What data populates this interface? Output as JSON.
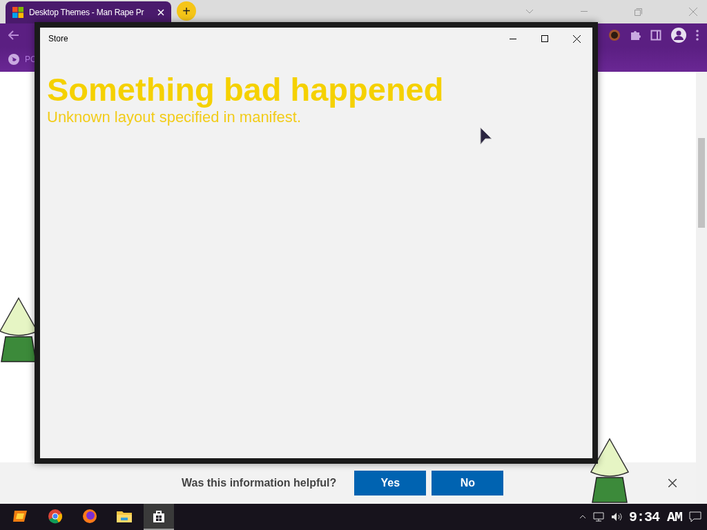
{
  "browser": {
    "tab": {
      "title": "Desktop Themes - Man Rape Pr",
      "selected": true
    },
    "new_tab_button": "+",
    "bookmark": "PC"
  },
  "store_window": {
    "title": "Store",
    "heading": "Something bad happened",
    "message": "Unknown layout specified in manifest."
  },
  "feedback": {
    "question": "Was this information helpful?",
    "buttons": [
      "Yes",
      "No"
    ]
  },
  "taskbar": {
    "apps": [
      {
        "kind": "launcher",
        "selected": false
      },
      {
        "kind": "chrome",
        "selected": false
      },
      {
        "kind": "firefox",
        "selected": false
      },
      {
        "kind": "folder",
        "selected": false
      },
      {
        "kind": "store",
        "selected": true
      }
    ],
    "clock": "9:34 AM"
  }
}
